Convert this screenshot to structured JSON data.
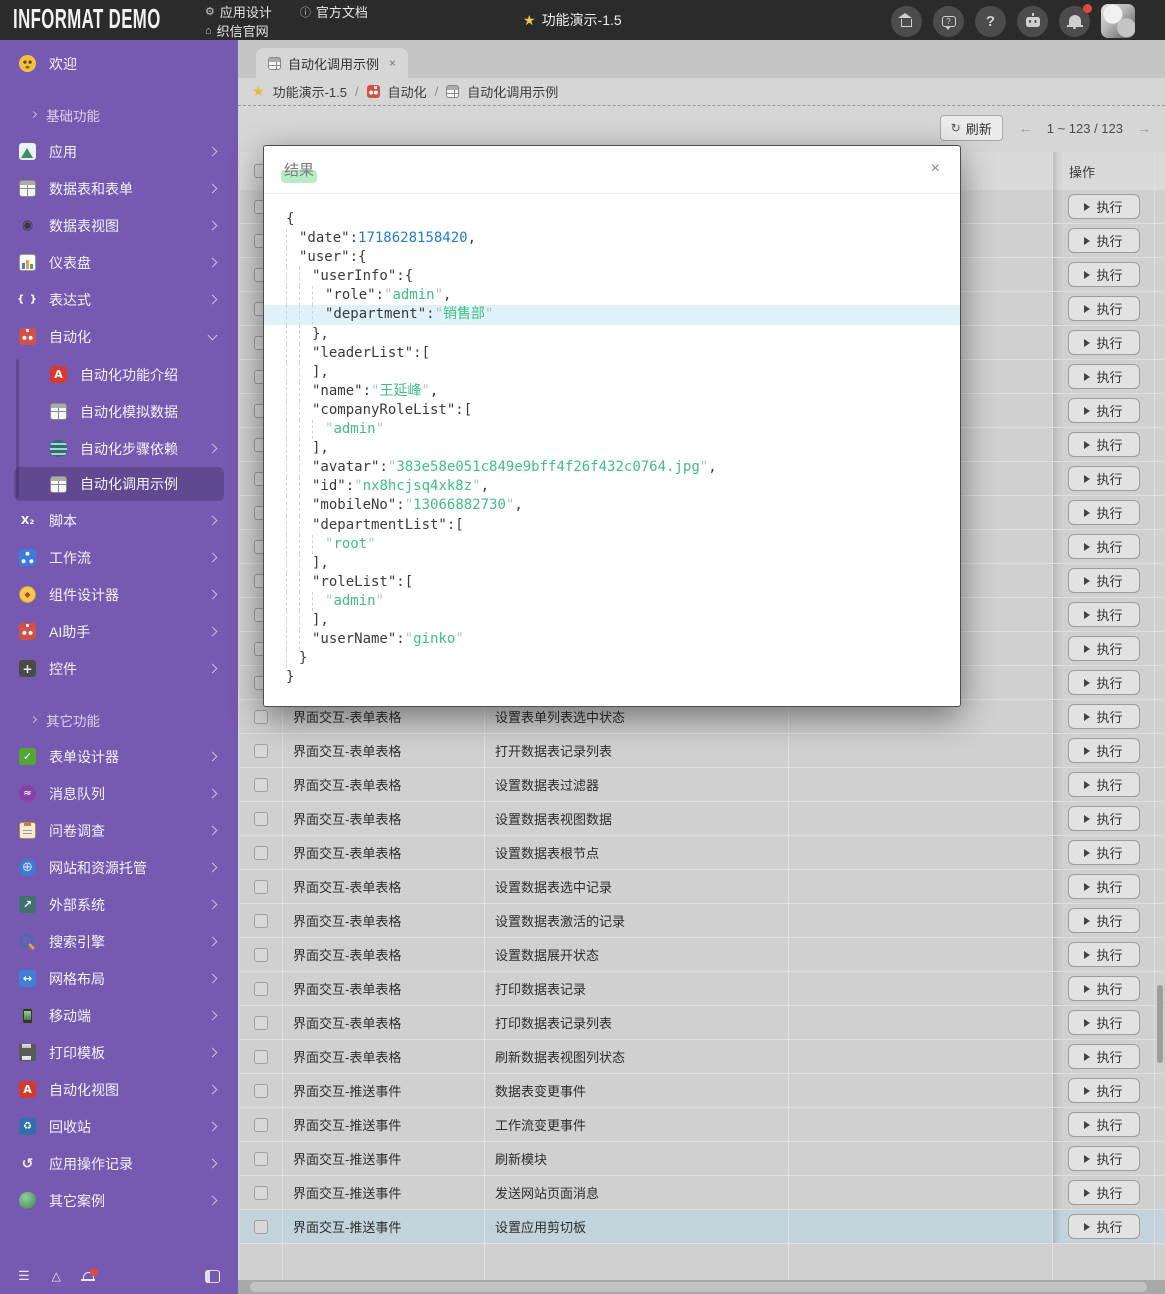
{
  "topbar": {
    "logo": "INFORMAT DEMO",
    "nav": [
      {
        "label": "应用设计",
        "icon": "gear-icon"
      },
      {
        "label": "官方文档",
        "icon": "info-icon"
      },
      {
        "label": "织信官网",
        "icon": "home-icon"
      }
    ],
    "app_title": "功能演示-1.5",
    "right_icons": [
      "home-icon",
      "feedback-icon",
      "help-icon",
      "robot-icon",
      "notification-icon"
    ],
    "notification_badge_color": "#e0493c"
  },
  "sidebar": {
    "color": "#7659b0",
    "items": [
      {
        "kind": "item",
        "icon": "welcome-icon",
        "label": "欢迎",
        "arrow": null
      },
      {
        "kind": "group",
        "label": "基础功能"
      },
      {
        "kind": "item",
        "icon": "mountain-icon",
        "label": "应用",
        "arrow": "right"
      },
      {
        "kind": "item",
        "icon": "table-icon",
        "label": "数据表和表单",
        "arrow": "right"
      },
      {
        "kind": "item",
        "icon": "view-icon",
        "label": "数据表视图",
        "arrow": "right"
      },
      {
        "kind": "item",
        "icon": "dashboard-icon",
        "label": "仪表盘",
        "arrow": "right"
      },
      {
        "kind": "item",
        "icon": "braces-icon",
        "label": "表达式",
        "arrow": "right"
      },
      {
        "kind": "item",
        "icon": "robot2-icon",
        "label": "自动化",
        "arrow": "down"
      },
      {
        "kind": "sub",
        "icon": "a-icon",
        "label": "自动化功能介绍",
        "arrow": null
      },
      {
        "kind": "sub",
        "icon": "table-icon",
        "label": "自动化模拟数据",
        "arrow": null
      },
      {
        "kind": "sub",
        "icon": "db-icon",
        "label": "自动化步骤依赖",
        "arrow": "right"
      },
      {
        "kind": "sub",
        "icon": "table-icon",
        "label": "自动化调用示例",
        "arrow": null,
        "active": true
      },
      {
        "kind": "item",
        "icon": "script-icon",
        "label": "脚本",
        "arrow": "right"
      },
      {
        "kind": "item",
        "icon": "workflow-icon",
        "label": "工作流",
        "arrow": "right"
      },
      {
        "kind": "item",
        "icon": "compass-icon",
        "label": "组件设计器",
        "arrow": "right"
      },
      {
        "kind": "item",
        "icon": "robot2-icon",
        "label": "AI助手",
        "arrow": "right"
      },
      {
        "kind": "item",
        "icon": "widget-icon",
        "label": "控件",
        "arrow": "right"
      },
      {
        "kind": "group",
        "label": "其它功能"
      },
      {
        "kind": "item",
        "icon": "formcheck-icon",
        "label": "表单设计器",
        "arrow": "right"
      },
      {
        "kind": "item",
        "icon": "queue-icon",
        "label": "消息队列",
        "arrow": "right"
      },
      {
        "kind": "item",
        "icon": "survey-icon",
        "label": "问卷调查",
        "arrow": "right"
      },
      {
        "kind": "item",
        "icon": "globe-icon",
        "label": "网站和资源托管",
        "arrow": "right"
      },
      {
        "kind": "item",
        "icon": "external-icon",
        "label": "外部系统",
        "arrow": "right"
      },
      {
        "kind": "item",
        "icon": "searchc-icon",
        "label": "搜索引擎",
        "arrow": "right"
      },
      {
        "kind": "item",
        "icon": "gridlayout-icon",
        "label": "网格布局",
        "arrow": "right"
      },
      {
        "kind": "item",
        "icon": "mobile-icon",
        "label": "移动端",
        "arrow": "right"
      },
      {
        "kind": "item",
        "icon": "printer-icon",
        "label": "打印模板",
        "arrow": "right"
      },
      {
        "kind": "item",
        "icon": "a-icon",
        "label": "自动化视图",
        "arrow": "right"
      },
      {
        "kind": "item",
        "icon": "recycle-icon",
        "label": "回收站",
        "arrow": "right"
      },
      {
        "kind": "item",
        "icon": "history-icon",
        "label": "应用操作记录",
        "arrow": "right"
      },
      {
        "kind": "item",
        "icon": "case-icon",
        "label": "其它案例",
        "arrow": "right"
      }
    ]
  },
  "tabs": [
    {
      "label": "自动化调用示例",
      "icon": "table-icon",
      "closable": true
    }
  ],
  "tab_close_glyph": "×",
  "breadcrumb": {
    "parts": [
      {
        "label": "功能演示-1.5",
        "icon": "star-icon"
      },
      {
        "label": "自动化",
        "icon": "robot-icon"
      },
      {
        "label": "自动化调用示例",
        "icon": "table-icon"
      }
    ],
    "separator": "/"
  },
  "toolbar": {
    "refresh_label": "刷新",
    "pager_text": "1 ~ 123 / 123",
    "prev_glyph": "←",
    "next_glyph": "→"
  },
  "table": {
    "action_header": "操作",
    "exec_label": "执行",
    "rows": [
      {
        "category": "",
        "name": ""
      },
      {
        "category": "",
        "name": ""
      },
      {
        "category": "",
        "name": ""
      },
      {
        "category": "",
        "name": ""
      },
      {
        "category": "",
        "name": ""
      },
      {
        "category": "",
        "name": ""
      },
      {
        "category": "",
        "name": ""
      },
      {
        "category": "",
        "name": ""
      },
      {
        "category": "",
        "name": ""
      },
      {
        "category": "",
        "name": ""
      },
      {
        "category": "",
        "name": ""
      },
      {
        "category": "",
        "name": ""
      },
      {
        "category": "",
        "name": ""
      },
      {
        "category": "",
        "name": ""
      },
      {
        "category": "",
        "name": ""
      },
      {
        "category": "界面交互-表单表格",
        "name": "设置表单列表选中状态"
      },
      {
        "category": "界面交互-表单表格",
        "name": "打开数据表记录列表"
      },
      {
        "category": "界面交互-表单表格",
        "name": "设置数据表过滤器"
      },
      {
        "category": "界面交互-表单表格",
        "name": "设置数据表视图数据"
      },
      {
        "category": "界面交互-表单表格",
        "name": "设置数据表根节点"
      },
      {
        "category": "界面交互-表单表格",
        "name": "设置数据表选中记录"
      },
      {
        "category": "界面交互-表单表格",
        "name": "设置数据表激活的记录"
      },
      {
        "category": "界面交互-表单表格",
        "name": "设置数据展开状态"
      },
      {
        "category": "界面交互-表单表格",
        "name": "打印数据表记录"
      },
      {
        "category": "界面交互-表单表格",
        "name": "打印数据表记录列表"
      },
      {
        "category": "界面交互-表单表格",
        "name": "刷新数据表视图列状态"
      },
      {
        "category": "界面交互-推送事件",
        "name": "数据表变更事件"
      },
      {
        "category": "界面交互-推送事件",
        "name": "工作流变更事件"
      },
      {
        "category": "界面交互-推送事件",
        "name": "刷新模块"
      },
      {
        "category": "界面交互-推送事件",
        "name": "发送网站页面消息"
      },
      {
        "category": "界面交互-推送事件",
        "name": "设置应用剪切板",
        "selected": true
      }
    ]
  },
  "modal": {
    "title": "结果",
    "close_glyph": "×",
    "highlight_color": "#e1f1fa",
    "json_lines": [
      {
        "ind": 0,
        "seg": [
          [
            "p",
            "{"
          ]
        ]
      },
      {
        "ind": 1,
        "seg": [
          [
            "k",
            "\"date\""
          ],
          [
            "p",
            ":"
          ],
          [
            "n",
            "1718628158420"
          ],
          [
            "p",
            ","
          ]
        ]
      },
      {
        "ind": 1,
        "seg": [
          [
            "k",
            "\"user\""
          ],
          [
            "p",
            ":{"
          ]
        ]
      },
      {
        "ind": 2,
        "seg": [
          [
            "k",
            "\"userInfo\""
          ],
          [
            "p",
            ":{"
          ]
        ]
      },
      {
        "ind": 3,
        "seg": [
          [
            "k",
            "\"role\""
          ],
          [
            "p",
            ":"
          ],
          [
            "q",
            "\""
          ],
          [
            "s",
            "admin"
          ],
          [
            "q",
            "\""
          ],
          [
            "p",
            ","
          ]
        ]
      },
      {
        "ind": 3,
        "hl": true,
        "seg": [
          [
            "k",
            "\"department\""
          ],
          [
            "p",
            ":"
          ],
          [
            "q",
            "\""
          ],
          [
            "s",
            "销售部"
          ],
          [
            "q",
            "\""
          ]
        ]
      },
      {
        "ind": 2,
        "seg": [
          [
            "p",
            "},"
          ]
        ]
      },
      {
        "ind": 2,
        "seg": [
          [
            "k",
            "\"leaderList\""
          ],
          [
            "p",
            ":["
          ]
        ]
      },
      {
        "ind": 2,
        "seg": [
          [
            "p",
            "],"
          ]
        ]
      },
      {
        "ind": 2,
        "seg": [
          [
            "k",
            "\"name\""
          ],
          [
            "p",
            ":"
          ],
          [
            "q",
            "\""
          ],
          [
            "s",
            "王延峰"
          ],
          [
            "q",
            "\""
          ],
          [
            "p",
            ","
          ]
        ]
      },
      {
        "ind": 2,
        "seg": [
          [
            "k",
            "\"companyRoleList\""
          ],
          [
            "p",
            ":["
          ]
        ]
      },
      {
        "ind": 3,
        "seg": [
          [
            "q",
            "\""
          ],
          [
            "s",
            "admin"
          ],
          [
            "q",
            "\""
          ]
        ]
      },
      {
        "ind": 2,
        "seg": [
          [
            "p",
            "],"
          ]
        ]
      },
      {
        "ind": 2,
        "seg": [
          [
            "k",
            "\"avatar\""
          ],
          [
            "p",
            ":"
          ],
          [
            "q",
            "\""
          ],
          [
            "s",
            "383e58e051c849e9bff4f26f432c0764.jpg"
          ],
          [
            "q",
            "\""
          ],
          [
            "p",
            ","
          ]
        ]
      },
      {
        "ind": 2,
        "seg": [
          [
            "k",
            "\"id\""
          ],
          [
            "p",
            ":"
          ],
          [
            "q",
            "\""
          ],
          [
            "s",
            "nx8hcjsq4xk8z"
          ],
          [
            "q",
            "\""
          ],
          [
            "p",
            ","
          ]
        ]
      },
      {
        "ind": 2,
        "seg": [
          [
            "k",
            "\"mobileNo\""
          ],
          [
            "p",
            ":"
          ],
          [
            "q",
            "\""
          ],
          [
            "s",
            "13066882730"
          ],
          [
            "q",
            "\""
          ],
          [
            "p",
            ","
          ]
        ]
      },
      {
        "ind": 2,
        "seg": [
          [
            "k",
            "\"departmentList\""
          ],
          [
            "p",
            ":["
          ]
        ]
      },
      {
        "ind": 3,
        "seg": [
          [
            "q",
            "\""
          ],
          [
            "s",
            "root"
          ],
          [
            "q",
            "\""
          ]
        ]
      },
      {
        "ind": 2,
        "seg": [
          [
            "p",
            "],"
          ]
        ]
      },
      {
        "ind": 2,
        "seg": [
          [
            "k",
            "\"roleList\""
          ],
          [
            "p",
            ":["
          ]
        ]
      },
      {
        "ind": 3,
        "seg": [
          [
            "q",
            "\""
          ],
          [
            "s",
            "admin"
          ],
          [
            "q",
            "\""
          ]
        ]
      },
      {
        "ind": 2,
        "seg": [
          [
            "p",
            "],"
          ]
        ]
      },
      {
        "ind": 2,
        "seg": [
          [
            "k",
            "\"userName\""
          ],
          [
            "p",
            ":"
          ],
          [
            "q",
            "\""
          ],
          [
            "s",
            "ginko"
          ],
          [
            "q",
            "\""
          ]
        ]
      },
      {
        "ind": 1,
        "seg": [
          [
            "p",
            "}"
          ]
        ]
      },
      {
        "ind": 0,
        "seg": [
          [
            "p",
            "}"
          ]
        ]
      }
    ]
  }
}
